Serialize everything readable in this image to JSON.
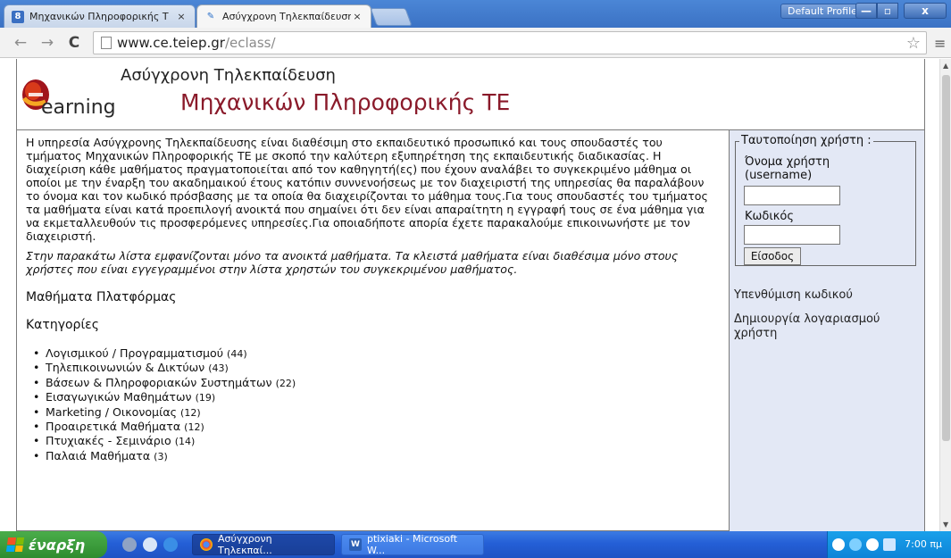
{
  "browser": {
    "tabs": [
      {
        "title": "Μηχανικών Πληροφορικής Τ",
        "close": "×"
      },
      {
        "title": "Ασύγχρονη Τηλεκπαίδευση",
        "close": "×"
      }
    ],
    "profile_button": "Default Profile",
    "window_controls": {
      "minimize": "—",
      "maximize": "▫",
      "close": "x"
    },
    "nav": {
      "back": "←",
      "forward": "→",
      "reload": "C"
    },
    "url_host": "www.ce.teiep.gr",
    "url_path": "/eclass/",
    "star": "☆",
    "menu": "≡"
  },
  "header": {
    "logo_word": "earning",
    "subtitle": "Ασύγχρονη Τηλεκπαίδευση",
    "title": "Μηχανικών Πληροφορικής ΤΕ"
  },
  "content": {
    "intro": "Η υπηρεσία Ασύγχρονης Τηλεκπαίδευσης είναι διαθέσιμη στο εκπαιδευτικό προσωπικό και τους σπουδαστές του τμήματος Μηχανικών Πληροφορικής ΤΕ με σκοπό την καλύτερη εξυπηρέτηση της εκπαιδευτικής διαδικασίας. Η διαχείριση κάθε μαθήματος πραγματοποιείται από τον καθηγητή(ες) που έχουν αναλάβει το συγκεκριμένο μάθημα οι οποίοι με την έναρξη του ακαδημαικού έτους κατόπιν συννενοήσεως με τον διαχειριστή της υπηρεσίας θα παραλάβουν το όνομα και τον κωδικό πρόσβασης με τα οποία θα διαχειρίζονται το μάθημα τους.Για τους σπουδαστές του τμήματος τα μαθήματα είναι κατά προεπιλογή ανοικτά που σημαίνει ότι δεν είναι απαραίτητη η εγγραφή τους σε ένα μάθημα για να εκμεταλλευθούν τις προσφερόμενες υπηρεσίες.Για οποιαδήποτε απορία έχετε παρακαλούμε επικοινωνήστε με τον διαχειριστή.",
    "note": "Στην παρακάτω λίστα εμφανίζονται μόνο τα ανοικτά μαθήματα. Τα κλειστά μαθήματα είναι διαθέσιμα μόνο στους χρήστες που είναι εγγεγραμμένοι στην λίστα χρηστών του συγκεκριμένου μαθήματος.",
    "platform_title": "Μαθήματα Πλατφόρμας",
    "categories_title": "Κατηγορίες",
    "categories": [
      {
        "name": "Λογισμικού / Προγραμματισμού",
        "count": "(44)"
      },
      {
        "name": "Τηλεπικοινωνιών & Δικτύων",
        "count": "(43)"
      },
      {
        "name": "Βάσεων & Πληροφοριακών Συστημάτων",
        "count": "(22)"
      },
      {
        "name": "Εισαγωγικών Μαθημάτων",
        "count": "(19)"
      },
      {
        "name": "Marketing / Οικονομίας",
        "count": "(12)"
      },
      {
        "name": "Προαιρετικά Μαθήματα",
        "count": "(12)"
      },
      {
        "name": "Πτυχιακές - Σεμινάριο",
        "count": "(14)"
      },
      {
        "name": "Παλαιά Μαθήματα",
        "count": "(3)"
      }
    ]
  },
  "sidebar": {
    "login_legend": "Ταυτοποίηση χρήστη :",
    "username_label": "Όνομα χρήστη (username)",
    "username_value": "",
    "password_label": "Κωδικός",
    "password_value": "",
    "login_button": "Είσοδος",
    "forgot_link": "Υπενθύμιση κωδικού",
    "register_link": "Δημιουργία λογαριασμού χρήστη"
  },
  "taskbar": {
    "start_label": "έναρξη",
    "tasks": [
      {
        "label": "Ασύγχρονη Τηλεκπαί..."
      },
      {
        "label": "ptixiaki - Microsoft W..."
      }
    ],
    "clock": "7:00 πμ"
  }
}
